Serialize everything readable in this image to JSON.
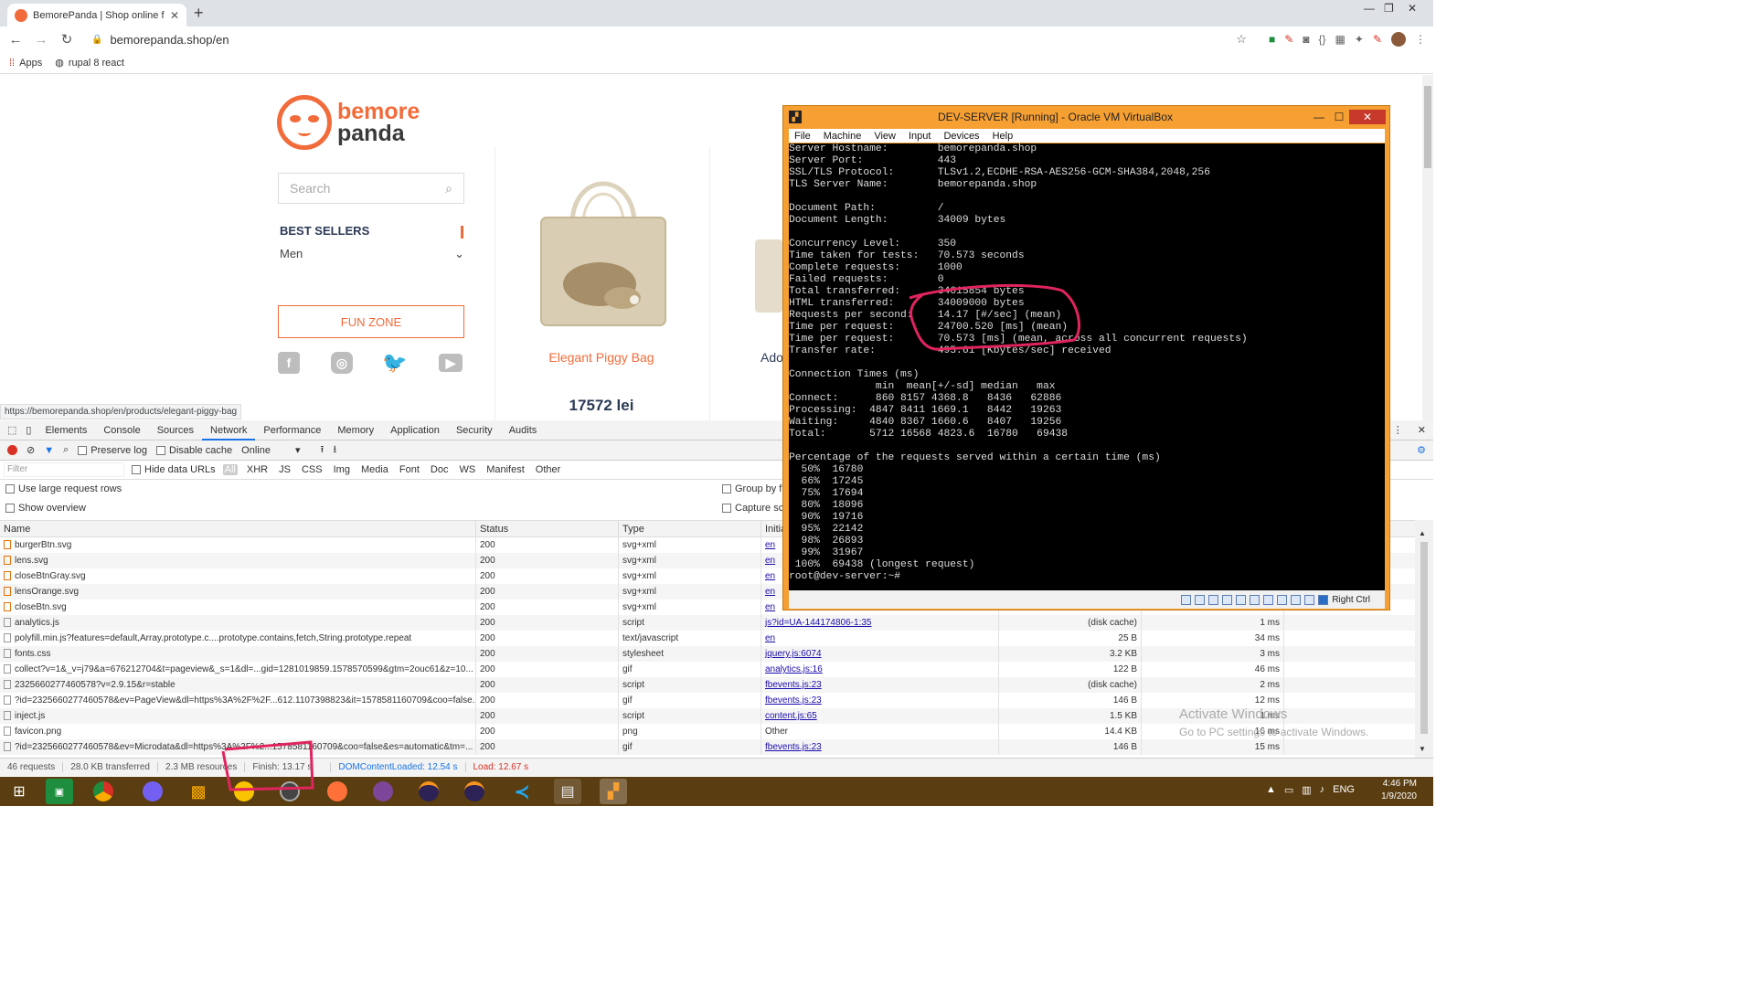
{
  "browser": {
    "tab_title": "BemorePanda | Shop online for S",
    "url": "bemorepanda.shop/en",
    "bookmarks": [
      "Apps",
      "rupal 8 react"
    ]
  },
  "site": {
    "logo_line1": "bemore",
    "logo_line2": "panda",
    "search_placeholder": "Search",
    "best_sellers": "BEST SELLERS",
    "category": "Men",
    "fun_zone": "FUN ZONE",
    "product_name": "Elegant Piggy Bag",
    "product_price": "17572 lei",
    "product2_name": "Ado",
    "hover_url": "https://bemorepanda.shop/en/products/elegant-piggy-bag"
  },
  "devtools": {
    "tabs": [
      "Elements",
      "Console",
      "Sources",
      "Network",
      "Performance",
      "Memory",
      "Application",
      "Security",
      "Audits"
    ],
    "active_tab": "Network",
    "preserve_log": "Preserve log",
    "disable_cache": "Disable cache",
    "throttle": "Online",
    "filter_placeholder": "Filter",
    "hide_data_urls": "Hide data URLs",
    "filter_types": [
      "All",
      "XHR",
      "JS",
      "CSS",
      "Img",
      "Media",
      "Font",
      "Doc",
      "WS",
      "Manifest",
      "Other"
    ],
    "options": [
      "Use large request rows",
      "Show overview",
      "Group by fr",
      "Capture scre"
    ],
    "columns": [
      "Name",
      "Status",
      "Type",
      "Initia"
    ],
    "rows": [
      {
        "name": "burgerBtn.svg",
        "status": "200",
        "type": "svg+xml",
        "initiator": "en",
        "size": "",
        "time": ""
      },
      {
        "name": "lens.svg",
        "status": "200",
        "type": "svg+xml",
        "initiator": "en",
        "size": "",
        "time": ""
      },
      {
        "name": "closeBtnGray.svg",
        "status": "200",
        "type": "svg+xml",
        "initiator": "en",
        "size": "",
        "time": ""
      },
      {
        "name": "lensOrange.svg",
        "status": "200",
        "type": "svg+xml",
        "initiator": "en",
        "size": "",
        "time": ""
      },
      {
        "name": "closeBtn.svg",
        "status": "200",
        "type": "svg+xml",
        "initiator": "en",
        "size": "",
        "time": ""
      },
      {
        "name": "analytics.js",
        "status": "200",
        "type": "script",
        "initiator": "js?id=UA-144174806-1:35",
        "size": "(disk cache)",
        "time": "1 ms"
      },
      {
        "name": "polyfill.min.js?features=default,Array.prototype.c....prototype.contains,fetch,String.prototype.repeat",
        "status": "200",
        "type": "text/javascript",
        "initiator": "en",
        "size": "25 B",
        "time": "34 ms"
      },
      {
        "name": "fonts.css",
        "status": "200",
        "type": "stylesheet",
        "initiator": "jquery.js:6074",
        "size": "3.2 KB",
        "time": "3 ms"
      },
      {
        "name": "collect?v=1&_v=j79&a=676212704&t=pageview&_s=1&dl=...gid=1281019859.1578570599&gtm=2ouc61&z=10...",
        "status": "200",
        "type": "gif",
        "initiator": "analytics.js:16",
        "size": "122 B",
        "time": "46 ms"
      },
      {
        "name": "2325660277460578?v=2.9.15&r=stable",
        "status": "200",
        "type": "script",
        "initiator": "fbevents.js:23",
        "size": "(disk cache)",
        "time": "2 ms"
      },
      {
        "name": "?id=2325660277460578&ev=PageView&dl=https%3A%2F%2F...612.1107398823&it=1578581160709&coo=false...",
        "status": "200",
        "type": "gif",
        "initiator": "fbevents.js:23",
        "size": "146 B",
        "time": "12 ms"
      },
      {
        "name": "inject.js",
        "status": "200",
        "type": "script",
        "initiator": "content.js:65",
        "size": "1.5 KB",
        "time": "1 ms"
      },
      {
        "name": "favicon.png",
        "status": "200",
        "type": "png",
        "initiator": "Other",
        "size": "14.4 KB",
        "time": "16 ms"
      },
      {
        "name": "?id=2325660277460578&ev=Microdata&dl=https%3A%2F%2...1578581160709&coo=false&es=automatic&tm=...",
        "status": "200",
        "type": "gif",
        "initiator": "fbevents.js:23",
        "size": "146 B",
        "time": "15 ms"
      }
    ],
    "status_bar": {
      "requests": "46 requests",
      "transferred": "28.0 KB transferred",
      "resources": "2.3 MB resources",
      "finish": "Finish: 13.17 s",
      "dcl": "DOMContentLoaded: 12.54 s",
      "load": "Load: 12.67 s"
    }
  },
  "virtualbox": {
    "title": "DEV-SERVER [Running] - Oracle VM VirtualBox",
    "menu": [
      "File",
      "Machine",
      "View",
      "Input",
      "Devices",
      "Help"
    ],
    "host_key": "Right Ctrl",
    "terminal_lines": [
      "Server Hostname:        bemorepanda.shop",
      "Server Port:            443",
      "SSL/TLS Protocol:       TLSv1.2,ECDHE-RSA-AES256-GCM-SHA384,2048,256",
      "TLS Server Name:        bemorepanda.shop",
      "",
      "Document Path:          /",
      "Document Length:        34009 bytes",
      "",
      "Concurrency Level:      350",
      "Time taken for tests:   70.573 seconds",
      "Complete requests:      1000",
      "Failed requests:        0",
      "Total transferred:      34615854 bytes",
      "HTML transferred:       34009000 bytes",
      "Requests per second:    14.17 [#/sec] (mean)",
      "Time per request:       24700.520 [ms] (mean)",
      "Time per request:       70.573 [ms] (mean, across all concurrent requests)",
      "Transfer rate:          495.61 [Kbytes/sec] received",
      "",
      "Connection Times (ms)",
      "              min  mean[+/-sd] median   max",
      "Connect:      860 8157 4368.8   8436   62886",
      "Processing:  4847 8411 1669.1   8442   19263",
      "Waiting:     4840 8367 1660.6   8407   19256",
      "Total:       5712 16568 4823.6  16780   69438",
      "",
      "Percentage of the requests served within a certain time (ms)",
      "  50%  16780",
      "  66%  17245",
      "  75%  17694",
      "  80%  18096",
      "  90%  19716",
      "  95%  22142",
      "  98%  26893",
      "  99%  31967",
      " 100%  69438 (longest request)",
      "root@dev-server:~#"
    ]
  },
  "windows": {
    "watermark_title": "Activate Windows",
    "watermark_sub": "Go to PC settings to activate Windows.",
    "lang": "ENG",
    "time": "4:46 PM",
    "date": "1/9/2020"
  },
  "colors": {
    "brand_orange": "#f26b3a",
    "annotation": "#e0245e",
    "taskbar": "#5a3d10"
  }
}
